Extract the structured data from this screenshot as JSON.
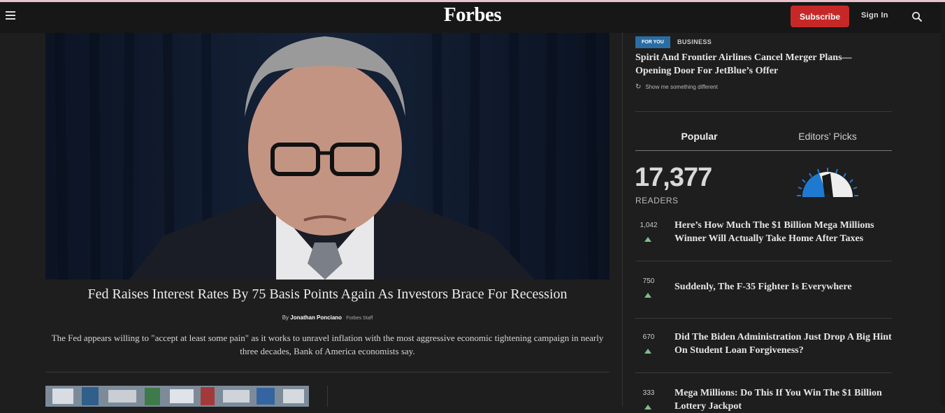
{
  "header": {
    "logo": "Forbes",
    "subscribe_label": "Subscribe",
    "signin_label": "Sign In"
  },
  "hero": {
    "title": "Fed Raises Interest Rates By 75 Basis Points Again As Investors Brace For Recession",
    "by_prefix": "By",
    "author": "Jonathan Ponciano",
    "author_role": "Forbes Staff",
    "description": "The Fed appears willing to \"accept at least some pain\" as it works to unravel inflation with the most aggressive economic tightening campaign in nearly three decades, Bank of America economists say."
  },
  "sidebar": {
    "badge": "FOR YOU",
    "category": "BUSINESS",
    "headline": "Spirit And Frontier Airlines Cancel Merger Plans—Opening Door For JetBlue’s Offer",
    "show_me": "Show me something different",
    "tabs": [
      {
        "label": "Popular",
        "active": true
      },
      {
        "label": "Editors’ Picks",
        "active": false
      }
    ],
    "readers_count": "17,377",
    "readers_label": "READERS",
    "gauge_color": "#1e7ad1",
    "trend_color": "#7fbf8a",
    "popular": [
      {
        "count": "1,042",
        "title": "Here’s How Much The $1 Billion Mega Millions Winner Will Actually Take Home After Taxes"
      },
      {
        "count": "750",
        "title": "Suddenly, The F-35 Fighter Is Everywhere"
      },
      {
        "count": "670",
        "title": "Did The Biden Administration Just Drop A Big Hint On Student Loan Forgiveness?"
      },
      {
        "count": "333",
        "title": "Mega Millions: Do This If You Win The $1 Billion Lottery Jackpot"
      }
    ]
  },
  "colors": {
    "background": "#1e1e1e",
    "header": "#171717",
    "subscribe": "#c62828",
    "badge": "#2b6da3"
  }
}
